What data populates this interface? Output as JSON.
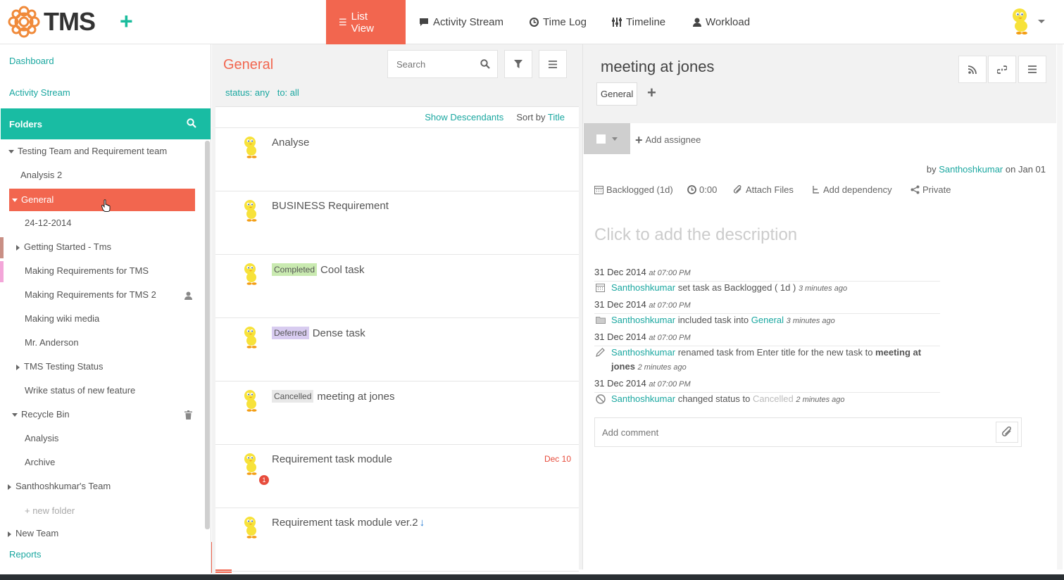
{
  "app": {
    "logo_text": "TMS"
  },
  "nav": {
    "tabs": [
      {
        "label": "List View",
        "icon": "list-icon"
      },
      {
        "label": "Activity Stream",
        "icon": "comment-icon"
      },
      {
        "label": "Time Log",
        "icon": "clock-icon"
      },
      {
        "label": "Timeline",
        "icon": "sliders-icon"
      },
      {
        "label": "Workload",
        "icon": "user-icon"
      }
    ],
    "active_tab": "List View"
  },
  "sidebar": {
    "dashboard": "Dashboard",
    "activity_stream": "Activity Stream",
    "folders_label": "Folders",
    "tree": {
      "team1": "Testing Team and Requirement team",
      "analysis2": "Analysis 2",
      "general": "General",
      "d24": "24-12-2014",
      "getting_started": "Getting Started - Tms",
      "making_req": "Making Requirements for TMS",
      "making_req2": "Making Requirements for TMS 2",
      "wiki": "Making wiki media",
      "anderson": "Mr. Anderson",
      "tms_status": "TMS Testing Status",
      "wrike": "Wrike status of new feature",
      "recycle": "Recycle Bin",
      "analysis": "Analysis",
      "archive": "Archive",
      "santhosh_team": "Santhoshkumar's Team",
      "new_folder": "+ new folder",
      "new_team": "New Team"
    },
    "reports": "Reports"
  },
  "list": {
    "title": "General",
    "search_placeholder": "Search",
    "filter_status": "status: any",
    "filter_to": "to: all",
    "show_descendants": "Show Descendants",
    "sort_prefix": "Sort by",
    "sort_field": "Title",
    "tasks": [
      {
        "badge": "",
        "title": "Analyse",
        "date": ""
      },
      {
        "badge": "",
        "title": "BUSINESS Requirement",
        "date": ""
      },
      {
        "badge": "Completed",
        "title": "Cool task",
        "date": ""
      },
      {
        "badge": "Deferred",
        "title": "Dense task",
        "date": ""
      },
      {
        "badge": "Cancelled",
        "title": "meeting at jones",
        "date": ""
      },
      {
        "badge": "",
        "title": "Requirement task module",
        "date": "Dec 10",
        "count": "1"
      },
      {
        "badge": "",
        "title": "Requirement task module ver.2",
        "date": ""
      }
    ],
    "badge_colors": {
      "Completed": "#c9eab0",
      "Deferred": "#d8ccf0",
      "Cancelled": "#e8e8e8"
    }
  },
  "detail": {
    "title": "meeting at jones",
    "folder_tag": "General",
    "add_assignee": "Add assignee",
    "by_prefix": "by",
    "author": "Santhoshkumar",
    "on_date": "on Jan 01",
    "status": "Backlogged (1d)",
    "time": "0:00",
    "attach": "Attach Files",
    "dependency": "Add dependency",
    "privacy": "Private",
    "description_placeholder": "Click to add the description",
    "activity": [
      {
        "date": "31 Dec 2014",
        "time": "at 07:00 PM",
        "user": "Santhoshkumar",
        "text": "set task as Backlogged ( 1d )",
        "ago": "3 minutes ago"
      },
      {
        "date": "31 Dec 2014",
        "time": "at 07:00 PM",
        "user": "Santhoshkumar",
        "text": "included task into",
        "link": "General",
        "ago": "3 minutes ago"
      },
      {
        "date": "31 Dec 2014",
        "time": "at 07:00 PM",
        "user": "Santhoshkumar",
        "text": "renamed task from Enter title for the new task to",
        "bold1": "meeting at",
        "bold2": "jones",
        "ago": "2 minutes ago"
      },
      {
        "date": "31 Dec 2014",
        "time": "at 07:00 PM",
        "user": "Santhoshkumar",
        "text": "changed status to",
        "status": "Cancelled",
        "ago": "2 minutes ago"
      }
    ],
    "comment_placeholder": "Add comment"
  },
  "colors": {
    "accent": "#f2664f",
    "teal": "#19bca3",
    "link": "#1aa7a0"
  }
}
